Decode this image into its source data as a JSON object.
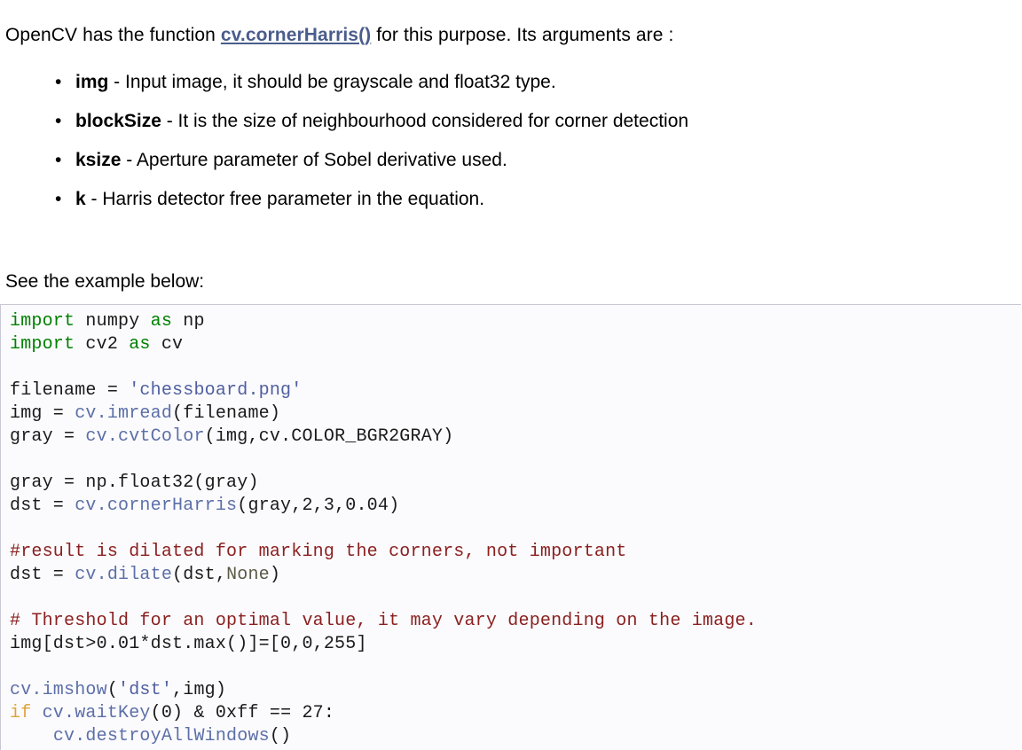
{
  "intro": {
    "before": "OpenCV has the function ",
    "function_ref": "cv.cornerHarris()",
    "after": " for this purpose. Its arguments are :"
  },
  "arguments": {
    "bullet_glyph": "•",
    "items": [
      {
        "name": "img",
        "desc": " - Input image, it should be grayscale and float32 type."
      },
      {
        "name": "blockSize",
        "desc": " - It is the size of neighbourhood considered for corner detection"
      },
      {
        "name": "ksize",
        "desc": " - Aperture parameter of Sobel derivative used."
      },
      {
        "name": "k",
        "desc": " - Harris detector free parameter in the equation."
      }
    ]
  },
  "see_below": "See the example below:",
  "code": {
    "language": "python",
    "lines": [
      [
        {
          "t": "import",
          "c": "kw"
        },
        {
          "t": " numpy ",
          "c": "plain"
        },
        {
          "t": "as",
          "c": "kw"
        },
        {
          "t": " np",
          "c": "plain"
        }
      ],
      [
        {
          "t": "import",
          "c": "kw"
        },
        {
          "t": " cv2 ",
          "c": "plain"
        },
        {
          "t": "as",
          "c": "kw"
        },
        {
          "t": " cv",
          "c": "plain"
        }
      ],
      [
        {
          "t": "",
          "c": "plain"
        }
      ],
      [
        {
          "t": "filename = ",
          "c": "plain"
        },
        {
          "t": "'chessboard.png'",
          "c": "str"
        }
      ],
      [
        {
          "t": "img = ",
          "c": "plain"
        },
        {
          "t": "cv.imread",
          "c": "fn"
        },
        {
          "t": "(filename)",
          "c": "plain"
        }
      ],
      [
        {
          "t": "gray = ",
          "c": "plain"
        },
        {
          "t": "cv.cvtColor",
          "c": "fn"
        },
        {
          "t": "(img,cv.COLOR_BGR2GRAY)",
          "c": "plain"
        }
      ],
      [
        {
          "t": "",
          "c": "plain"
        }
      ],
      [
        {
          "t": "gray = np.float32(gray)",
          "c": "plain"
        }
      ],
      [
        {
          "t": "dst = ",
          "c": "plain"
        },
        {
          "t": "cv.cornerHarris",
          "c": "fn"
        },
        {
          "t": "(gray,2,3,0.04)",
          "c": "plain"
        }
      ],
      [
        {
          "t": "",
          "c": "plain"
        }
      ],
      [
        {
          "t": "#result is dilated for marking the corners, not important",
          "c": "comment"
        }
      ],
      [
        {
          "t": "dst = ",
          "c": "plain"
        },
        {
          "t": "cv.dilate",
          "c": "fn"
        },
        {
          "t": "(dst,",
          "c": "plain"
        },
        {
          "t": "None",
          "c": "const"
        },
        {
          "t": ")",
          "c": "plain"
        }
      ],
      [
        {
          "t": "",
          "c": "plain"
        }
      ],
      [
        {
          "t": "# Threshold for an optimal value, it may vary depending on the image.",
          "c": "comment"
        }
      ],
      [
        {
          "t": "img[dst>0.01*dst.max()]=[0,0,255]",
          "c": "plain"
        }
      ],
      [
        {
          "t": "",
          "c": "plain"
        }
      ],
      [
        {
          "t": "cv.imshow",
          "c": "fn"
        },
        {
          "t": "(",
          "c": "plain"
        },
        {
          "t": "'dst'",
          "c": "str"
        },
        {
          "t": ",img)",
          "c": "plain"
        }
      ],
      [
        {
          "t": "if",
          "c": "kw2"
        },
        {
          "t": " ",
          "c": "plain"
        },
        {
          "t": "cv.waitKey",
          "c": "fn"
        },
        {
          "t": "(0) & 0xff == 27:",
          "c": "plain"
        }
      ],
      [
        {
          "t": "    ",
          "c": "plain"
        },
        {
          "t": "cv.destroyAllWindows",
          "c": "fn"
        },
        {
          "t": "()",
          "c": "plain"
        }
      ]
    ]
  },
  "colors": {
    "function_ref": "#4a5c8c",
    "keyword": "#008000",
    "keyword_control": "#e0a23c",
    "string": "#4f5fa0",
    "function_name": "#5c6fa8",
    "comment": "#8b2020",
    "constant": "#5a5a46",
    "code_background": "#fbfbfd",
    "code_border": "#c8c8d4",
    "text": "#000000"
  }
}
